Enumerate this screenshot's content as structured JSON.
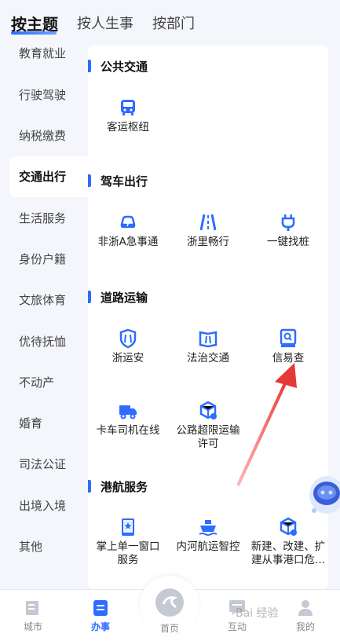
{
  "top_tabs": [
    "按主题",
    "按人生事",
    "按部门"
  ],
  "sidebar": {
    "items": [
      "教育就业",
      "行驶驾驶",
      "纳税缴费",
      "交通出行",
      "生活服务",
      "身份户籍",
      "文旅体育",
      "优待抚恤",
      "不动产",
      "婚育",
      "司法公证",
      "出境入境",
      "其他"
    ]
  },
  "sections": [
    {
      "title": "公共交通",
      "items": [
        {
          "label": "客运枢纽",
          "icon": "bus-icon"
        }
      ]
    },
    {
      "title": "驾车出行",
      "items": [
        {
          "label": "非浙A急事通",
          "icon": "car-alert-icon"
        },
        {
          "label": "浙里畅行",
          "icon": "road-icon"
        },
        {
          "label": "一键找桩",
          "icon": "charger-icon"
        }
      ]
    },
    {
      "title": "道路运输",
      "items": [
        {
          "label": "浙运安",
          "icon": "shield-road-icon"
        },
        {
          "label": "法治交通",
          "icon": "book-road-icon"
        },
        {
          "label": "信易查",
          "icon": "search-doc-icon"
        },
        {
          "label": "卡车司机在线",
          "icon": "truck-icon"
        },
        {
          "label": "公路超限运输",
          "label2": "许可",
          "icon": "box-icon"
        }
      ]
    },
    {
      "title": "港航服务",
      "items": [
        {
          "label": "掌上单一窗口",
          "label2": "服务",
          "icon": "phone-window-icon"
        },
        {
          "label": "内河航运智控",
          "icon": "ship-icon"
        },
        {
          "label": "新建、改建、扩",
          "label2": "建从事港口危...",
          "icon": "port-box-icon"
        }
      ]
    }
  ],
  "bottom_nav": [
    "城市",
    "办事",
    "首页",
    "互动",
    "我的"
  ],
  "watermark": "Bai 经验",
  "colors": {
    "accent": "#2d6cff",
    "arrow": "#e53935"
  }
}
